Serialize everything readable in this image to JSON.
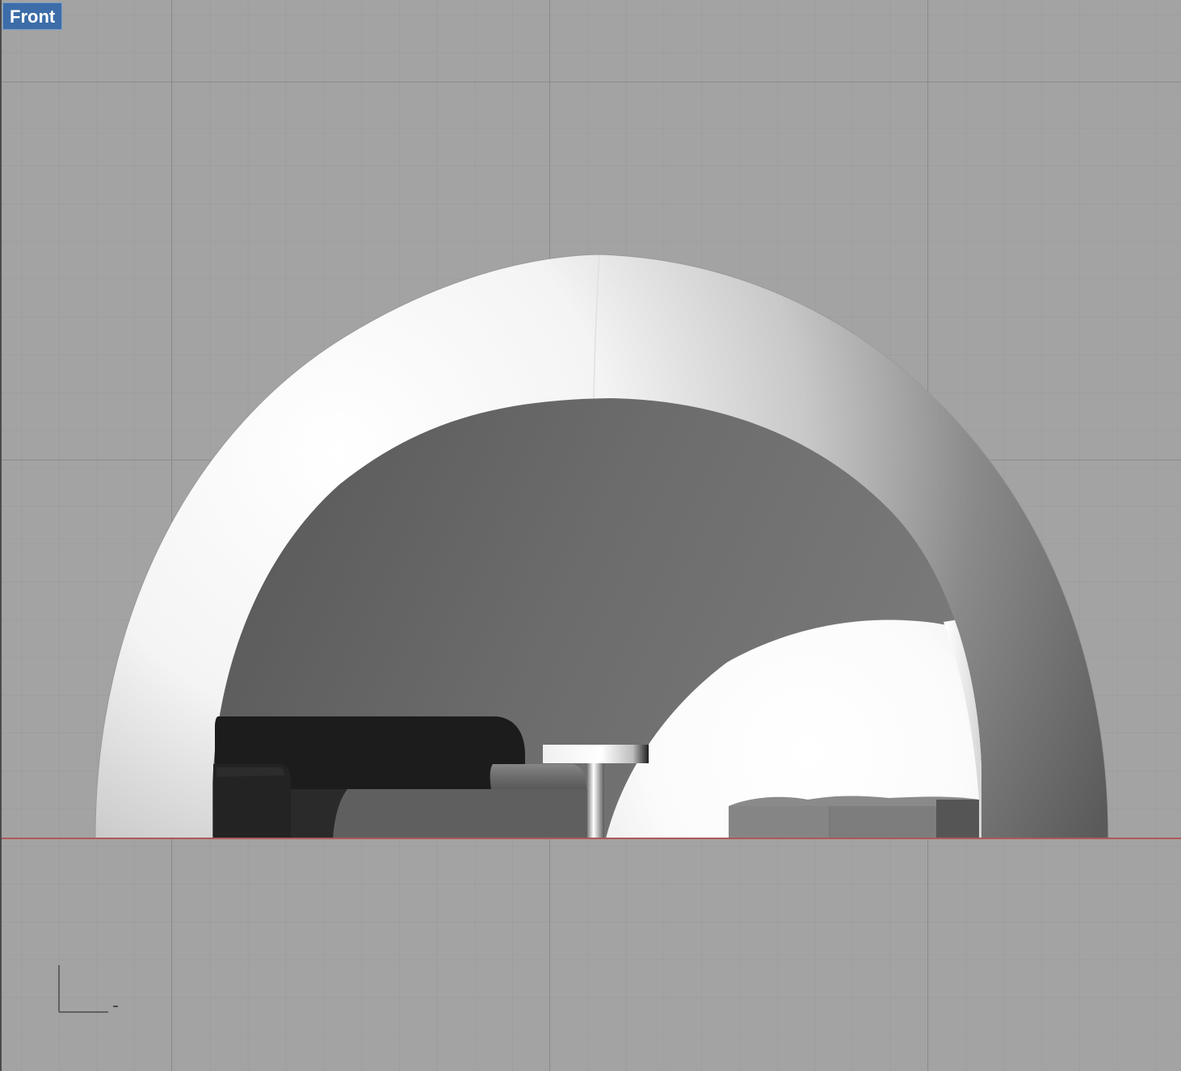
{
  "viewport": {
    "label": "Front",
    "projection": "orthographic-front",
    "display_mode": "shaded"
  },
  "colors": {
    "background": "#a3a3a3",
    "grid_minor": "#9a9a9a",
    "grid_major": "#8e8e8e",
    "x_axis_line": "#b05858",
    "label_bg": "#3c6da8",
    "label_text": "#ffffff"
  },
  "axis_widget": {
    "icon": "world-axes-icon"
  }
}
